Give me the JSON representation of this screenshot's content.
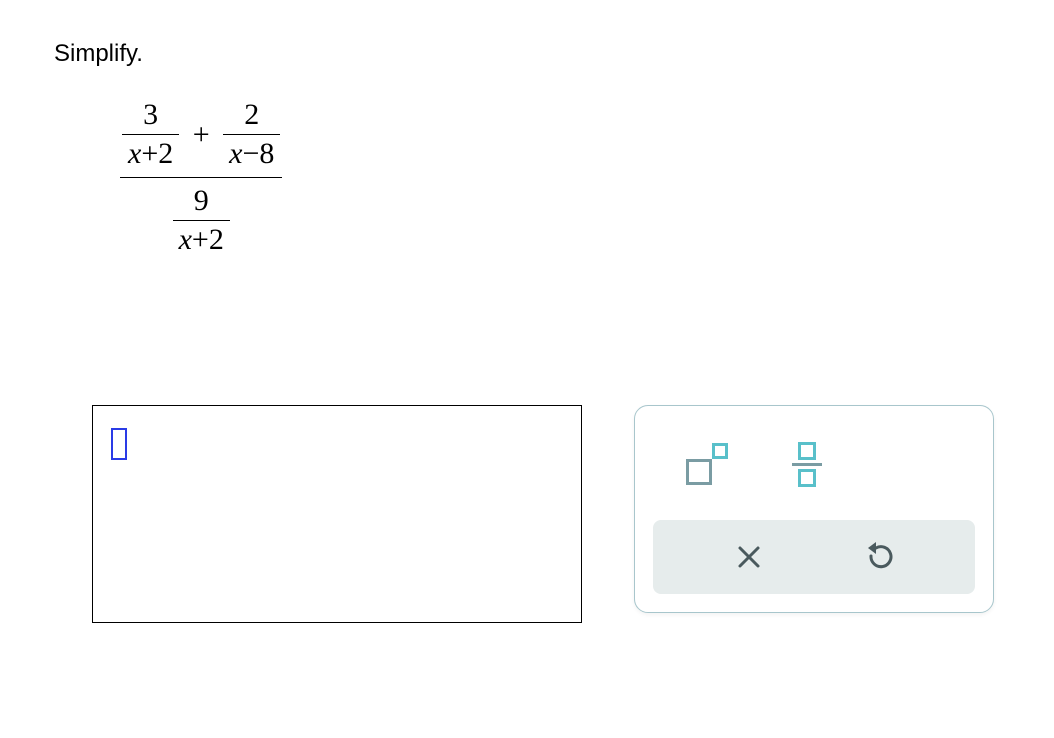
{
  "prompt": "Simplify.",
  "expression": {
    "top_left_num": "3",
    "top_left_den_prefix": "x",
    "top_left_den_op": "+",
    "top_left_den_val": "2",
    "plus": "+",
    "top_right_num": "2",
    "top_right_den_prefix": "x",
    "top_right_den_op": "−",
    "top_right_den_val": "8",
    "bottom_num": "9",
    "bottom_den_prefix": "x",
    "bottom_den_op": "+",
    "bottom_den_val": "2"
  },
  "toolbox": {
    "exponent": "exponent",
    "fraction": "fraction",
    "clear": "clear",
    "reset": "reset"
  }
}
